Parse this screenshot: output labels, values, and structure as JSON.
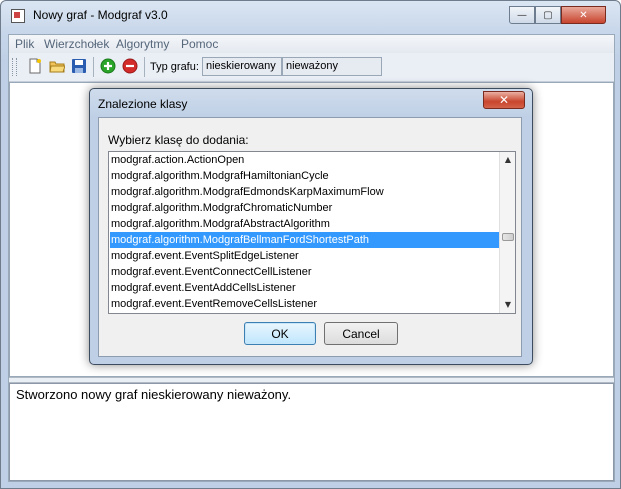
{
  "window": {
    "title": "Nowy graf - Modgraf v3.0",
    "min_glyph": "—",
    "max_glyph": "▢",
    "close_glyph": "✕"
  },
  "menu": [
    "Plik",
    "Wierzchołek",
    "Algorytmy",
    "Pomoc"
  ],
  "toolbar": {
    "icons": [
      "new-file-icon",
      "open-folder-icon",
      "save-disk-icon",
      "add-green-icon",
      "remove-red-icon"
    ],
    "graph_type_label": "Typ grafu:",
    "direction_value": "nieskierowany",
    "weight_value": "nieważony"
  },
  "log": {
    "message": "Stworzono nowy graf nieskierowany nieważony."
  },
  "dialog": {
    "title": "Znalezione klasy",
    "close_glyph": "✕",
    "prompt": "Wybierz klasę do dodania:",
    "items": [
      "modgraf.action.ActionOpen",
      "modgraf.algorithm.ModgrafHamiltonianCycle",
      "modgraf.algorithm.ModgrafEdmondsKarpMaximumFlow",
      "modgraf.algorithm.ModgrafChromaticNumber",
      "modgraf.algorithm.ModgrafAbstractAlgorithm",
      "modgraf.algorithm.ModgrafBellmanFordShortestPath",
      "modgraf.event.EventSplitEdgeListener",
      "modgraf.event.EventConnectCellListener",
      "modgraf.event.EventAddCellsListener",
      "modgraf.event.EventRemoveCellsListener"
    ],
    "selected_index": 5,
    "scroll_up": "▲",
    "scroll_down": "▼",
    "ok_label": "OK",
    "cancel_label": "Cancel"
  },
  "colors": {
    "selection": "#3399ff",
    "add_icon": "#2aa52a",
    "remove_icon": "#d32a2a"
  }
}
